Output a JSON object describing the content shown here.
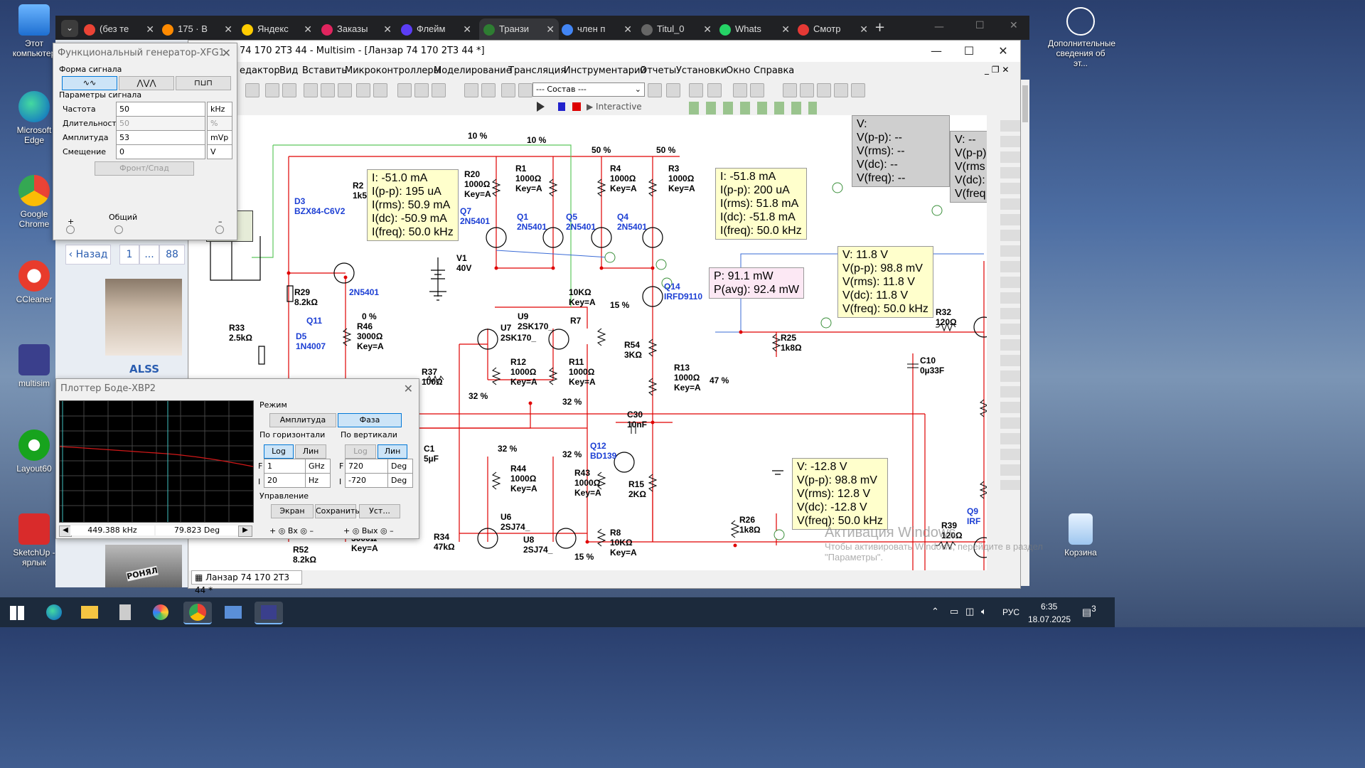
{
  "desktop": {
    "icons": [
      {
        "label": "Этот компьютер",
        "name": "this-pc-icon"
      },
      {
        "label": "Microsoft Edge",
        "name": "edge-icon"
      },
      {
        "label": "Google Chrome",
        "name": "chrome-icon"
      },
      {
        "label": "CCleaner",
        "name": "ccleaner-icon"
      },
      {
        "label": "multisim",
        "name": "multisim-icon"
      },
      {
        "label": "Layout60",
        "name": "layout-icon"
      },
      {
        "label": "SketchUp - ярлык",
        "name": "sketchup-icon"
      }
    ],
    "right_icons": [
      {
        "label": "Дополнительные сведения об эт...",
        "name": "info-icon"
      },
      {
        "label": "Корзина",
        "name": "recycle-bin-icon"
      }
    ]
  },
  "browser": {
    "tabs": [
      {
        "label": "(без те",
        "color": "#ea4335"
      },
      {
        "label": "175 · В",
        "color": "#ff8a00"
      },
      {
        "label": "Яндекс",
        "color": "#ffcc00"
      },
      {
        "label": "Заказы",
        "color": "#e0245e"
      },
      {
        "label": "Флейм",
        "color": "#5b3df5"
      },
      {
        "label": "Транзи",
        "color": "#2e7d32"
      },
      {
        "label": "член п",
        "color": "#4285f4"
      },
      {
        "label": "Titul_0",
        "color": "#666666"
      },
      {
        "label": "Whats",
        "color": "#25d366"
      },
      {
        "label": "Смотр",
        "color": "#e53935"
      }
    ],
    "new_tab": "+"
  },
  "multisim": {
    "title": "74 170 2Т3 44 - Multisim - [Ланзар 74 170 2Т3 44 *]",
    "menu": [
      "едактор",
      "Вид",
      "Вставить",
      "Микроконтроллеры",
      "Моделирование",
      "Трансляция",
      "Инструментарий",
      "Отчеты",
      "Установки",
      "Окно",
      "Справка"
    ],
    "combo": "--- Состав ---",
    "interactive": "Interactive",
    "doc_tab": "Ланзар 74 170 2Т3 44 *"
  },
  "circuit": {
    "percents": [
      "10 %",
      "10 %",
      "50 %",
      "50 %",
      "0 %",
      "15 %",
      "32 %",
      "32 %",
      "32 %",
      "32 %",
      "15 %",
      "47 %"
    ],
    "components": [
      {
        "t": "R20\n1000Ω\nKey=A",
        "blue": false
      },
      {
        "t": "R1\n1000Ω\nKey=A",
        "blue": false
      },
      {
        "t": "R4\n1000Ω\nKey=A",
        "blue": false
      },
      {
        "t": "R3\n1000Ω\nKey=A",
        "blue": false
      },
      {
        "t": "Q7\n2N5401",
        "blue": true
      },
      {
        "t": "Q1\n2N5401",
        "blue": true
      },
      {
        "t": "Q5\n2N5401",
        "blue": true
      },
      {
        "t": "Q4\n2N5401",
        "blue": true
      },
      {
        "t": "V1\n40V",
        "blue": false
      },
      {
        "t": "D3\nBZX84-C6V2",
        "blue": true
      },
      {
        "t": "R2\n1k5",
        "blue": false
      },
      {
        "t": "2N5401",
        "blue": true
      },
      {
        "t": "R29\n8.2kΩ",
        "blue": false
      },
      {
        "t": "Q11",
        "blue": true
      },
      {
        "t": "R33\n2.5kΩ",
        "blue": false
      },
      {
        "t": "D5\n1N4007",
        "blue": true
      },
      {
        "t": "R46\n3000Ω\nKey=A",
        "blue": false
      },
      {
        "t": "U9\n2SK170_",
        "blue": false
      },
      {
        "t": "U7\n2SK170_",
        "blue": false
      },
      {
        "t": "R7",
        "blue": false
      },
      {
        "t": "10KΩ\nKey=A",
        "blue": false
      },
      {
        "t": "Q14\nIRFD9110",
        "blue": true
      },
      {
        "t": "R12\n1000Ω\nKey=A",
        "blue": false
      },
      {
        "t": "R11\n1000Ω\nKey=A",
        "blue": false
      },
      {
        "t": "R37\n100Ω",
        "blue": false
      },
      {
        "t": "R54\n3KΩ",
        "blue": false
      },
      {
        "t": "R13\n1000Ω\nKey=A",
        "blue": false
      },
      {
        "t": "R25\n1k8Ω",
        "blue": false
      },
      {
        "t": "R32\n120Ω",
        "blue": false
      },
      {
        "t": "C10\n0µ33F",
        "blue": false
      },
      {
        "t": "C30\n10nF",
        "blue": false
      },
      {
        "t": "Q12\nBD139",
        "blue": true
      },
      {
        "t": "C1\n5µF",
        "blue": false
      },
      {
        "t": "R44\n1000Ω\nKey=A",
        "blue": false
      },
      {
        "t": "R43\n1000Ω\nKey=A",
        "blue": false
      },
      {
        "t": "R15\n2KΩ",
        "blue": false
      },
      {
        "t": "U6\n2SJ74_",
        "blue": false
      },
      {
        "t": "U8\n2SJ74_",
        "blue": false
      },
      {
        "t": "R8\n10KΩ\nKey=A",
        "blue": false
      },
      {
        "t": "R34\n47kΩ",
        "blue": false
      },
      {
        "t": "R52\n8.2kΩ",
        "blue": false
      },
      {
        "t": "R26\n1k8Ω",
        "blue": false
      },
      {
        "t": "R39\n120Ω",
        "blue": false
      },
      {
        "t": "Q9\nIRF",
        "blue": true
      },
      {
        "t": "3000Ω\nKey=A",
        "blue": false
      }
    ],
    "probes": {
      "i1": [
        "I: -51.0 mA",
        "I(p-p): 195 uA",
        "I(rms): 50.9 mA",
        "I(dc): -50.9 mA",
        "I(freq): 50.0 kHz"
      ],
      "i2": [
        "I: -51.8 mA",
        "I(p-p): 200 uA",
        "I(rms): 51.8 mA",
        "I(dc): -51.8 mA",
        "I(freq): 50.0 kHz"
      ],
      "p1": [
        "P: 91.1 mW",
        "P(avg): 92.4 mW"
      ],
      "v1": [
        "V: 11.8 V",
        "V(p-p): 98.8 mV",
        "V(rms): 11.8 V",
        "V(dc): 11.8 V",
        "V(freq): 50.0 kHz"
      ],
      "v2": [
        "V: -12.8 V",
        "V(p-p): 98.8 mV",
        "V(rms): 12.8 V",
        "V(dc): -12.8 V",
        "V(freq): 50.0 kHz"
      ],
      "g1": [
        "V:",
        "V(p-p): --",
        "V(rms): --",
        "V(dc): --",
        "V(freq): --"
      ],
      "g2": [
        "V: --",
        "V(p-p)",
        "V(rms",
        "V(dc):",
        "V(freq"
      ]
    }
  },
  "funcgen": {
    "title": "Функциональный генератор-XFG1",
    "waveform_label": "Форма сигнала",
    "params_label": "Параметры сигнала",
    "rows": [
      {
        "label": "Частота",
        "value": "50",
        "unit": "kHz"
      },
      {
        "label": "Длительность",
        "value": "50",
        "unit": "%"
      },
      {
        "label": "Амплитуда",
        "value": "53",
        "unit": "mVp"
      },
      {
        "label": "Смещение",
        "value": "0",
        "unit": "V"
      }
    ],
    "rise_fall": "Фронт/Спад",
    "plus": "+",
    "common": "Общий",
    "minus": "–"
  },
  "bode": {
    "title": "Плоттер Боде-XBP2",
    "mode_label": "Режим",
    "amp": "Амплитуда",
    "phase": "Фаза",
    "horiz": "По горизонтали",
    "vert": "По вертикали",
    "log": "Log",
    "lin": "Лин",
    "h_f": "1",
    "h_f_unit": "GHz",
    "h_i": "20",
    "h_i_unit": "Hz",
    "v_f": "720",
    "v_f_unit": "Deg",
    "v_i": "-720",
    "v_i_unit": "Deg",
    "F": "F",
    "I": "I",
    "control": "Управление",
    "screen": "Экран",
    "save": "Сохранить",
    "set": "Уст...",
    "freq_readout": "449.388 kHz",
    "deg_readout": "79.823 Deg",
    "in": "Вх",
    "out": "Вых"
  },
  "forum": {
    "back": "Назад",
    "p1": "1",
    "dots": "...",
    "p88": "88",
    "user": "ALSS",
    "cat_caption": "РОНЯЛ"
  },
  "watermark": {
    "title": "Активация Windows",
    "line1": "Чтобы активировать Windows, перейдите в раздел",
    "line2": "\"Параметры\"."
  },
  "tray": {
    "lang": "РУС",
    "time": "6:35",
    "date": "18.07.2025",
    "notif": "3"
  },
  "colors": {
    "wire_red": "#e00000",
    "wire_green": "#5ec85e",
    "probe_yellow": "#ffffcc",
    "blue_label": "#1c3fd4"
  }
}
